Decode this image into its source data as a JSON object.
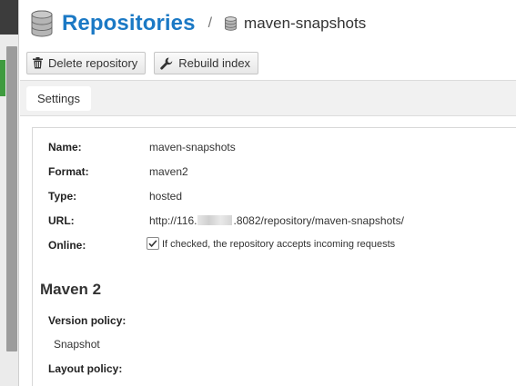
{
  "header": {
    "title": "Repositories",
    "separator": "/",
    "subtitle": "maven-snapshots",
    "icon": "database-icon"
  },
  "toolbar": {
    "delete_label": "Delete repository",
    "delete_icon": "trash-icon",
    "rebuild_label": "Rebuild index",
    "rebuild_icon": "wrench-icon"
  },
  "tabs": [
    {
      "label": "Settings",
      "active": true
    }
  ],
  "details": {
    "name_label": "Name:",
    "name_value": "maven-snapshots",
    "format_label": "Format:",
    "format_value": "maven2",
    "type_label": "Type:",
    "type_value": "hosted",
    "url_label": "URL:",
    "url_prefix": "http://116.",
    "url_suffix": ".8082/repository/maven-snapshots/",
    "online_label": "Online:",
    "online_checked": true,
    "online_text": "If checked, the repository accepts incoming requests"
  },
  "maven": {
    "section_title": "Maven 2",
    "version_policy_label": "Version policy:",
    "version_policy_value": "Snapshot",
    "layout_policy_label": "Layout policy:"
  },
  "colors": {
    "title": "#1b79c5",
    "accent_green": "#3f9b3f",
    "tab_bar": "#f1f1f1"
  }
}
